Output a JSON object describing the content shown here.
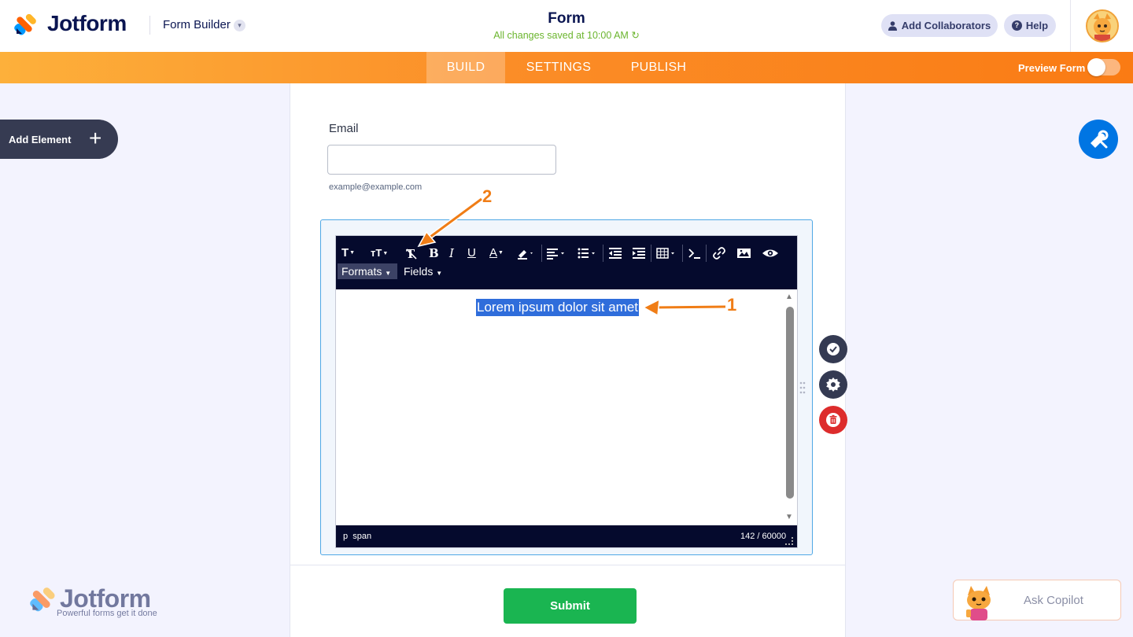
{
  "header": {
    "logo_text": "Jotform",
    "builder_label": "Form Builder",
    "form_title": "Form",
    "save_status": "All changes saved at 10:00 AM",
    "collab_label": "Add Collaborators",
    "help_label": "Help"
  },
  "nav": {
    "tabs": [
      {
        "label": "BUILD",
        "active": true
      },
      {
        "label": "SETTINGS",
        "active": false
      },
      {
        "label": "PUBLISH",
        "active": false
      }
    ],
    "preview_label": "Preview Form",
    "preview_on": false
  },
  "left_panel": {
    "add_element_label": "Add Element"
  },
  "form": {
    "email": {
      "label": "Email",
      "value": "",
      "sublabel": "example@example.com"
    },
    "rich_text": {
      "toolbar_menus": [
        "Formats",
        "Fields"
      ],
      "content": "Lorem ipsum dolor sit amet",
      "status_path": "p  span",
      "char_count": "142 / 60000"
    },
    "submit_label": "Submit"
  },
  "footer": {
    "brand_text": "Jotform",
    "brand_tagline": "Powerful forms get it done",
    "copilot_label": "Ask Copilot"
  },
  "annotations": [
    "1",
    "2"
  ],
  "colors": {
    "accent_orange": "#fa8a1f",
    "submit_green": "#1ab551",
    "delete_red": "#dd2c2c",
    "designer_blue": "#0075e3",
    "editor_dark": "#050a2d",
    "selection_blue": "#2f6ddb"
  }
}
